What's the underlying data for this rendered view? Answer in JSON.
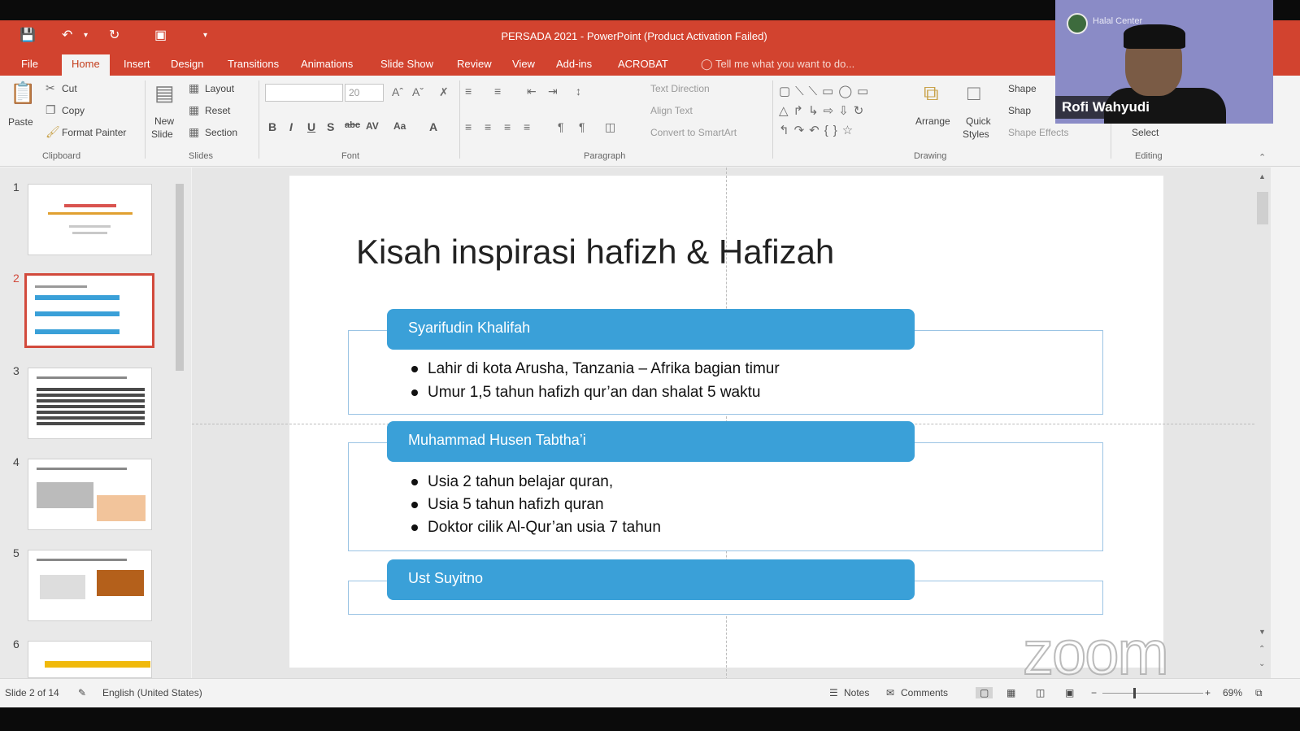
{
  "window": {
    "title": "PERSADA 2021 - PowerPoint (Product Activation Failed)"
  },
  "tabs": [
    {
      "label": "File"
    },
    {
      "label": "Home"
    },
    {
      "label": "Insert"
    },
    {
      "label": "Design"
    },
    {
      "label": "Transitions"
    },
    {
      "label": "Animations"
    },
    {
      "label": "Slide Show"
    },
    {
      "label": "Review"
    },
    {
      "label": "View"
    },
    {
      "label": "Add-ins"
    },
    {
      "label": "ACROBAT"
    }
  ],
  "tell_me": "Tell me what you want to do...",
  "ribbon": {
    "clipboard": {
      "paste": "Paste",
      "cut": "Cut",
      "copy": "Copy",
      "format_painter": "Format Painter",
      "group": "Clipboard"
    },
    "slides": {
      "new_slide": "New",
      "new_slide2": "Slide",
      "layout": "Layout",
      "reset": "Reset",
      "section": "Section",
      "group": "Slides"
    },
    "font": {
      "font_size": "20",
      "group": "Font"
    },
    "paragraph": {
      "text_direction": "Text Direction",
      "align_text": "Align Text",
      "convert": "Convert to SmartArt",
      "group": "Paragraph"
    },
    "drawing": {
      "arrange": "Arrange",
      "quick": "Quick",
      "styles": "Styles",
      "shape_fill": "Shape",
      "shape_outline": "Shap",
      "shape_effects": "Shape Effects",
      "group": "Drawing"
    },
    "editing": {
      "select": "Select",
      "group": "Editing"
    }
  },
  "thumbnails": [
    {
      "num": "1"
    },
    {
      "num": "2"
    },
    {
      "num": "3"
    },
    {
      "num": "4"
    },
    {
      "num": "5"
    },
    {
      "num": "6"
    }
  ],
  "slide": {
    "title": "Kisah inspirasi hafizh & Hafizah",
    "sections": [
      {
        "header": "Syarifudin Khalifah",
        "bullets": [
          "Lahir di kota Arusha, Tanzania – Afrika bagian timur",
          "Umur 1,5 tahun hafizh qur’an dan shalat 5 waktu"
        ]
      },
      {
        "header": "Muhammad Husen Tabtha’i",
        "bullets": [
          "Usia 2 tahun belajar quran,",
          "Usia 5 tahun hafizh quran",
          "Doktor cilik Al-Qur’an usia 7 tahun"
        ]
      },
      {
        "header": "Ust Suyitno",
        "bullets": []
      }
    ]
  },
  "status": {
    "slide_info": "Slide 2 of 14",
    "language": "English (United States)",
    "notes": "Notes",
    "comments": "Comments",
    "zoom": "69%"
  },
  "video": {
    "participant": "Rofi Wahyudi",
    "org": "Halal Center"
  },
  "watermark": "zoom",
  "colors": {
    "titlebar": "#d2432f",
    "accent_blue": "#3aa0d8",
    "selected_thumb": "#d24a3c"
  }
}
